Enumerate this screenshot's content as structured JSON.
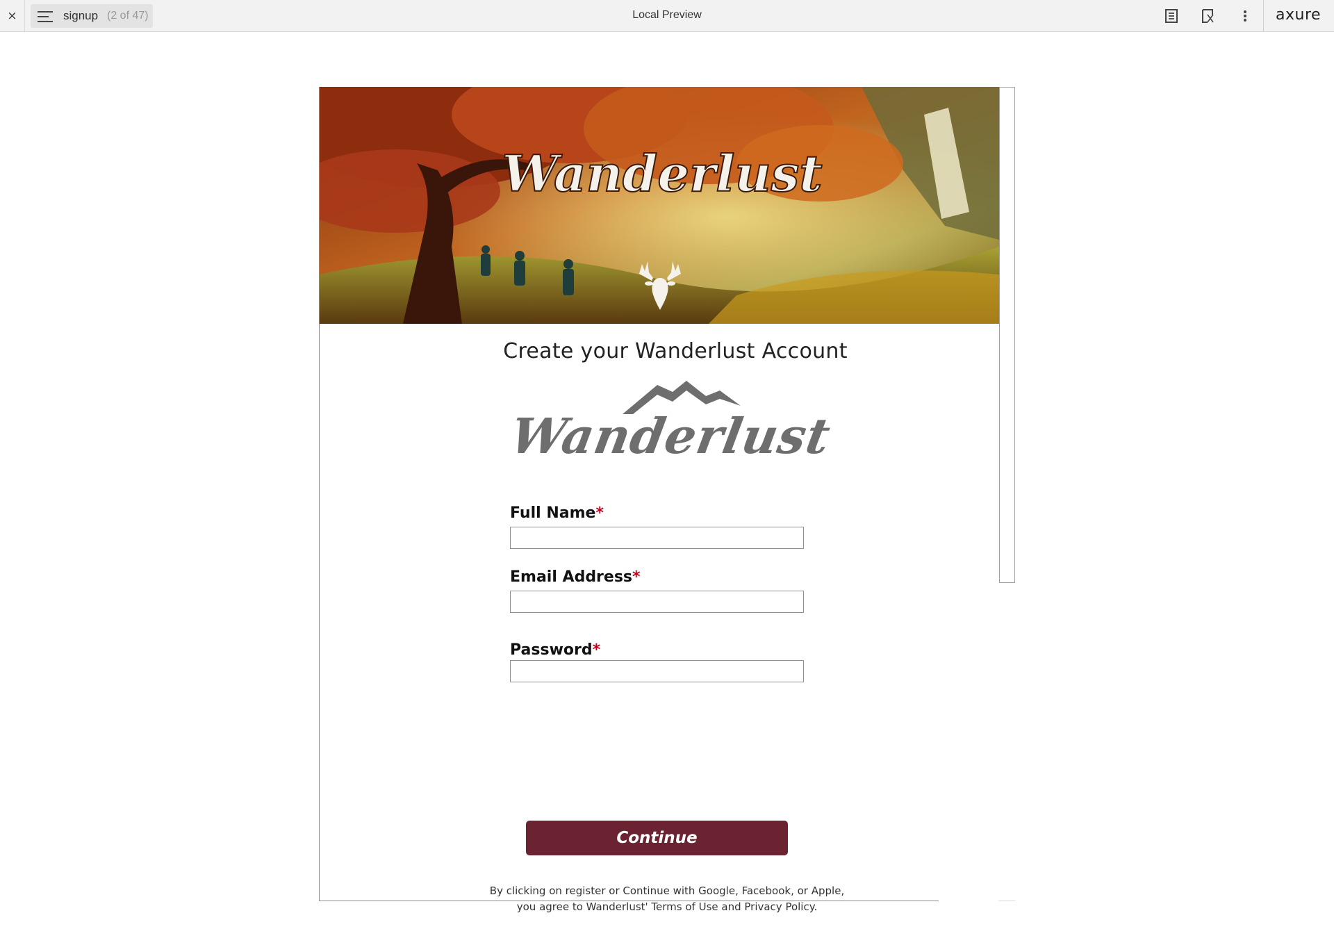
{
  "toolbar": {
    "close_glyph": "×",
    "page_name": "signup",
    "page_count": "(2 of 47)",
    "title": "Local Preview",
    "brand": "axure",
    "icons": [
      "page-notes-icon",
      "inspect-icon",
      "more-options-icon"
    ]
  },
  "hero": {
    "banner_text": "Wanderlust",
    "emblem": "deer-head-icon"
  },
  "form": {
    "heading": "Create your Wanderlust Account",
    "logo_text": "Wanderlust",
    "required_marker": "*",
    "fields": [
      {
        "label": "Full Name",
        "value": "",
        "placeholder": ""
      },
      {
        "label": "Email Address",
        "value": "",
        "placeholder": ""
      },
      {
        "label": "Password",
        "value": "",
        "placeholder": ""
      }
    ],
    "submit_label": "Continue",
    "legal_line1": "By clicking on register or Continue with Google, Facebook, or Apple,",
    "legal_line2": "you agree to Wanderlust' Terms of Use and Privacy Policy."
  },
  "colors": {
    "button": "#6c2331",
    "required": "#c0001a",
    "logo_gray": "#6e6e6e"
  }
}
